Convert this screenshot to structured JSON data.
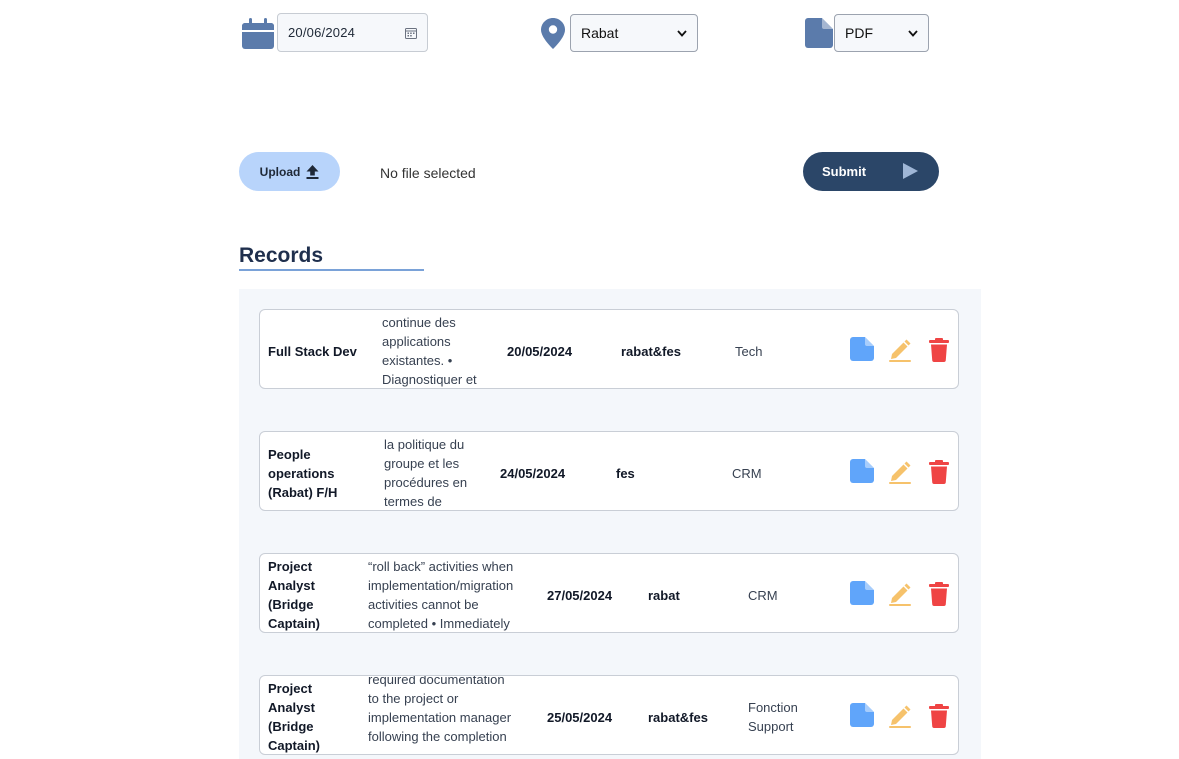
{
  "filters": {
    "date_value": "20/06/2024",
    "city_value": "Rabat",
    "format_value": "PDF"
  },
  "upload": {
    "button_label": "Upload",
    "status_text": "No file selected"
  },
  "submit": {
    "label": "Submit"
  },
  "records": {
    "title": "Records",
    "items": [
      {
        "title_lines": [
          "Full Stack Dev"
        ],
        "desc_lines": [
          "continue des",
          "applications",
          "existantes. •",
          "Diagnostiquer et"
        ],
        "date": "20/05/2024",
        "location": "rabat&fes",
        "category_lines": [
          "Tech"
        ]
      },
      {
        "title_lines": [
          "People",
          "operations",
          "(Rabat) F/H"
        ],
        "desc_lines": [
          "la politique du",
          "groupe et les",
          "procédures en",
          "termes de"
        ],
        "date": "24/05/2024",
        "location": "fes",
        "category_lines": [
          "CRM"
        ]
      },
      {
        "title_lines": [
          "Project",
          "Analyst",
          "(Bridge",
          "Captain)"
        ],
        "desc_lines": [
          "“roll back” activities when",
          "implementation/migration",
          "activities cannot be",
          "completed • Immediately"
        ],
        "date": "27/05/2024",
        "location": "rabat",
        "category_lines": [
          "CRM"
        ]
      },
      {
        "title_lines": [
          "Project",
          "Analyst",
          "(Bridge",
          "Captain)"
        ],
        "desc_lines": [
          "required documentation",
          "to the project or",
          "implementation manager",
          "following the completion"
        ],
        "date": "25/05/2024",
        "location": "rabat&fes",
        "category_lines": [
          "Fonction",
          "Support"
        ]
      }
    ]
  },
  "colors": {
    "primary": "#2b4668",
    "upload_bg": "#b8d4fb",
    "view_icon": "#60a5fa",
    "edit_icon": "#f6c26b",
    "delete_icon": "#ef4444",
    "filter_icon": "#5b7bab"
  },
  "icons": {
    "date": "calendar-icon",
    "city": "map-pin-icon",
    "format": "file-icon",
    "upload": "upload-icon",
    "submit": "play-icon",
    "view": "file-icon",
    "edit": "pencil-icon",
    "delete": "trash-icon"
  }
}
